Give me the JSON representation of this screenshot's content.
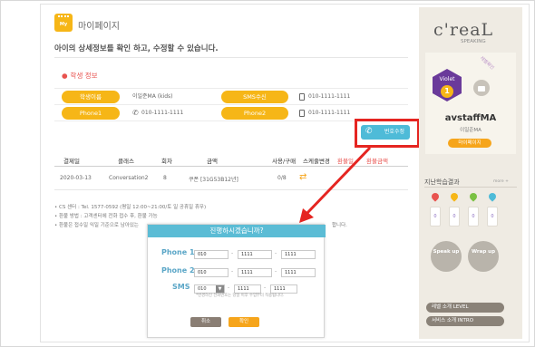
{
  "header": {
    "icon_label": "My",
    "title": "마이페이지",
    "description": "아이의 상세정보를 확인 하고, 수정할 수 있습니다."
  },
  "student_info": {
    "section_title": "학생 정보",
    "name_label": "학생이름",
    "name_value": "이일준MA (kids)",
    "sms_label": "SMS수신",
    "sms_value": "010-1111-1111",
    "phone1_label": "Phone1",
    "phone1_value": "010-1111-1111",
    "phone2_label": "Phone2",
    "phone2_value": "010-1111-1111",
    "change_button": "번호수정"
  },
  "history": {
    "headers": [
      "결제일",
      "클래스",
      "회차",
      "금액",
      "사용/구매",
      "스케줄변경",
      "환불일",
      "환불금액"
    ],
    "rows": [
      {
        "date": "2020-03-13",
        "class": "Conversation2",
        "count": "8",
        "amount": "쿠폰 [31G53B12년]",
        "used": "0/8"
      }
    ]
  },
  "notes": [
    "• CS 센터 : Tel. 1577-0592 (평일 12:00~21:00/토 일 공휴일 휴무)",
    "• 환불 방법 : 고객센터에 전화 접수 후, 환불 가능",
    "• 환불은 접수일 익일 기준으로 남아있는",
    "합니다."
  ],
  "modal": {
    "title": "진행하시겠습니까?",
    "phone1_label": "Phone 1",
    "phone1": [
      "010",
      "1111",
      "1111"
    ],
    "phone2_label": "Phone 2",
    "phone2": [
      "010",
      "1111",
      "1111"
    ],
    "sms_label": "SMS",
    "sms": [
      "010",
      "1111",
      "1111"
    ],
    "help_text": "*번경하신 전화번호는 당일 이후 수업부터 적용됩니다.",
    "cancel": "취소",
    "confirm": "확인"
  },
  "sidebar": {
    "logo": "c'reaL",
    "logo_sub": "SPEAKING",
    "ribbon": "레벨확인",
    "badge_label": "Violet",
    "badge_level": "1",
    "username": "avstaffMA",
    "usersub": "이일준MA",
    "mypage_button": "마이페이지",
    "past_title": "지난학습결과",
    "past_more": "more +",
    "grades": [
      "0",
      "0",
      "0",
      "0"
    ],
    "speak_up": "Speak up",
    "wrap_up": "Wrap up",
    "level_button": "레벨 소개 LEVEL",
    "intro_button": "서비스 소개 INTRO"
  },
  "colors": {
    "accent_yellow": "#f6b617",
    "accent_blue": "#4ebbd8",
    "highlight_red": "#e52521",
    "brand_purple": "#6a3a9a"
  }
}
